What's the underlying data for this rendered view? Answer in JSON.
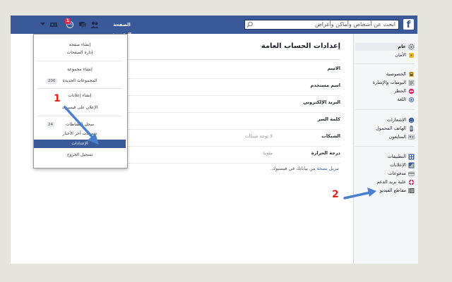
{
  "topbar": {
    "logo": "f",
    "search_placeholder": "ابحث عن أشخاص وأماكن وأغراض",
    "home_label": "الصفحة الرئيسية",
    "notification_count": "1",
    "icons": [
      "friends-icon",
      "messages-icon",
      "notifications-icon",
      "privacy-shortcuts-icon",
      "account-menu-chevron-icon"
    ]
  },
  "settings": {
    "title": "إعدادات الحساب العامة",
    "rows": [
      {
        "label": "الاسم",
        "value": ""
      },
      {
        "label": "اسم مستخدم",
        "value": ""
      },
      {
        "label": "البريد الإلكتروني",
        "value": ""
      },
      {
        "label": "كلمة السر",
        "value": ""
      },
      {
        "label": "الشبكات",
        "value": "لا توجد شبكات"
      },
      {
        "label": "درجة الحرارة",
        "value": "مئوية"
      }
    ],
    "download_link": "تنزيل نسخة",
    "download_text": "من بياناتك في فيسبوك."
  },
  "sidebar": {
    "groups": [
      [
        {
          "label": "عام",
          "icon": "gear-icon",
          "active": true
        },
        {
          "label": "الأمان",
          "icon": "security-badge-icon",
          "active": false
        }
      ],
      [
        {
          "label": "الخصوصية",
          "icon": "privacy-lock-icon",
          "active": false
        },
        {
          "label": "اليوميات والإشارة",
          "icon": "timeline-tagging-icon",
          "active": false
        },
        {
          "label": "الحظر",
          "icon": "blocking-icon",
          "active": false
        },
        {
          "label": "اللغة",
          "icon": "language-globe-icon",
          "active": false
        }
      ],
      [
        {
          "label": "الإشعارات",
          "icon": "notifications-globe-icon",
          "active": false
        },
        {
          "label": "الهاتف المحمول",
          "icon": "mobile-icon",
          "active": false
        },
        {
          "label": "المتابعون",
          "icon": "followers-icon",
          "active": false
        }
      ],
      [
        {
          "label": "التطبيقات",
          "icon": "apps-icon",
          "active": false
        },
        {
          "label": "الإعلانات",
          "icon": "ads-icon",
          "active": false
        },
        {
          "label": "مدفوعات",
          "icon": "payments-icon",
          "active": false
        },
        {
          "label": "علبة بريد الدعم",
          "icon": "support-inbox-icon",
          "active": false
        },
        {
          "label": "مقاطع الفيديو",
          "icon": "videos-icon",
          "active": false
        }
      ]
    ]
  },
  "menu": {
    "items": [
      {
        "label": "إنشاء صفحة",
        "badge": ""
      },
      {
        "label": "إدارة الصفحات",
        "badge": ""
      },
      {
        "label": "إنشاء مجموعة",
        "badge": ""
      },
      {
        "label": "المجموعات الجديدة",
        "badge": "200"
      },
      {
        "label": "إنشاء إعلانات",
        "badge": ""
      },
      {
        "label": "الإعلان على فيسبوك",
        "badge": ""
      },
      {
        "label": "سجل النشاطات",
        "badge": "24"
      },
      {
        "label": "تفضيلات آخر الأخبار",
        "badge": ""
      },
      {
        "label": "الإعدادات",
        "badge": "",
        "selected": true
      },
      {
        "label": "تسجيل الخروج",
        "badge": ""
      }
    ]
  },
  "annotations": {
    "first": "1",
    "second": "2",
    "color": "#e2231a",
    "arrow_color": "#4a7fd0"
  }
}
